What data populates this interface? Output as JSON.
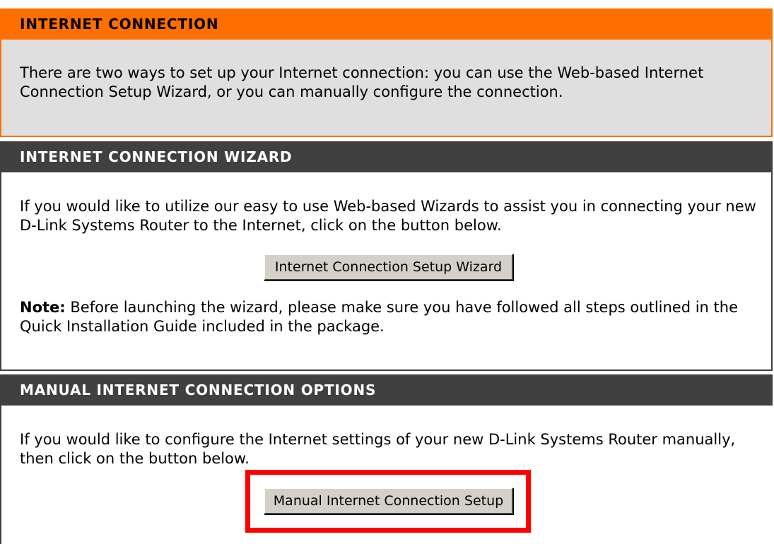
{
  "internet_connection": {
    "title": "INTERNET CONNECTION",
    "description": "There are two ways to set up your Internet connection: you can use the Web-based Internet Connection Setup Wizard, or you can manually configure the connection.",
    "colors": {
      "header_bg": "#ff6f00",
      "body_bg": "#dfdfdf"
    }
  },
  "wizard": {
    "title": "INTERNET CONNECTION WIZARD",
    "description": "If you would like to utilize our easy to use Web-based Wizards to assist you in connecting your new D-Link Systems Router to the Internet, click on the button below.",
    "button_label": "Internet Connection Setup Wizard",
    "note_label": "Note:",
    "note_text": " Before launching the wizard, please make sure you have followed all steps outlined in the Quick Installation Guide included in the package."
  },
  "manual": {
    "title": "MANUAL INTERNET CONNECTION OPTIONS",
    "description": "If you would like to configure the Internet settings of your new D-Link Systems Router manually, then click on the button below.",
    "button_label": "Manual Internet Connection Setup",
    "highlight_color": "#ff0000"
  },
  "colors": {
    "dark_header": "#404040",
    "button_face": "#d4d0c8"
  }
}
